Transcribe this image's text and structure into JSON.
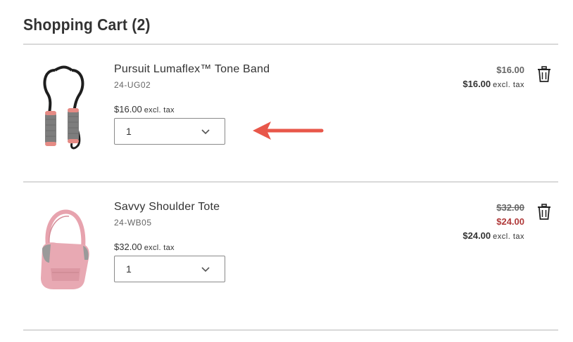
{
  "cart": {
    "title": "Shopping Cart (2)"
  },
  "items": [
    {
      "name": "Pursuit Lumaflex™ Tone Band",
      "sku": "24-UG02",
      "unit_price": "$16.00",
      "unit_price_tax_label": "excl. tax",
      "quantity": "1",
      "price_original": "$16.00",
      "price_total": "$16.00",
      "price_total_tax_label": "excl. tax",
      "image_icon": "jump-rope-image"
    },
    {
      "name": "Savvy Shoulder Tote",
      "sku": "24-WB05",
      "unit_price": "$32.00",
      "unit_price_tax_label": "excl. tax",
      "quantity": "1",
      "price_struck": "$32.00",
      "price_sale": "$24.00",
      "price_total": "$24.00",
      "price_total_tax_label": "excl. tax",
      "image_icon": "pink-tote-bag-image"
    }
  ],
  "icons": {
    "delete": "trash-icon",
    "dropdown": "chevron-down-icon",
    "annotation": "red-arrow-annotation"
  },
  "colors": {
    "sale_price": "#b03a3a",
    "annotation_arrow": "#e8574a",
    "divider": "#d9d9d9"
  }
}
